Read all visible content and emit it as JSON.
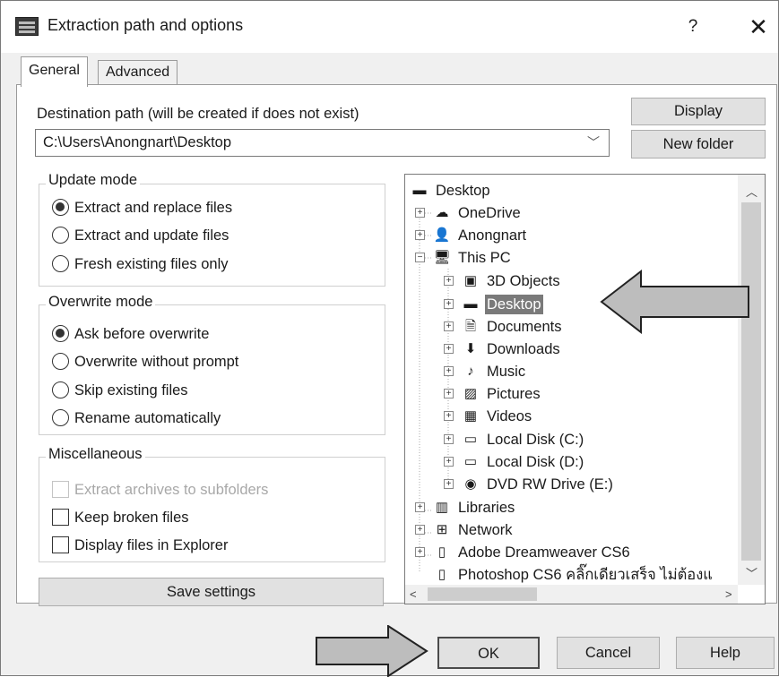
{
  "window": {
    "title": "Extraction path and options",
    "help_glyph": "?",
    "close_glyph": "✕"
  },
  "tabs": [
    {
      "label": "General"
    },
    {
      "label": "Advanced"
    }
  ],
  "destination": {
    "label": "Destination path (will be created if does not exist)",
    "value": "C:\\Users\\Anongnart\\Desktop",
    "display_button": "Display",
    "new_folder_button": "New folder"
  },
  "update_mode": {
    "title": "Update mode",
    "options": [
      {
        "label": "Extract and replace files",
        "selected": true
      },
      {
        "label": "Extract and update files",
        "selected": false
      },
      {
        "label": "Fresh existing files only",
        "selected": false
      }
    ]
  },
  "overwrite_mode": {
    "title": "Overwrite mode",
    "options": [
      {
        "label": "Ask before overwrite",
        "selected": true
      },
      {
        "label": "Overwrite without prompt",
        "selected": false
      },
      {
        "label": "Skip existing files",
        "selected": false
      },
      {
        "label": "Rename automatically",
        "selected": false
      }
    ]
  },
  "misc": {
    "title": "Miscellaneous",
    "options": [
      {
        "label": "Extract archives to subfolders",
        "checked": false,
        "disabled": true
      },
      {
        "label": "Keep broken files",
        "checked": false,
        "disabled": false
      },
      {
        "label": "Display files in Explorer",
        "checked": false,
        "disabled": false
      }
    ]
  },
  "save_settings": "Save settings",
  "tree": {
    "items": [
      {
        "label": "Desktop",
        "icon": "desktop-icon"
      },
      {
        "label": "OneDrive",
        "icon": "cloud-icon"
      },
      {
        "label": "Anongnart",
        "icon": "user-icon"
      },
      {
        "label": "This PC",
        "icon": "computer-icon"
      },
      {
        "label": "3D Objects",
        "icon": "cube-icon"
      },
      {
        "label": "Desktop",
        "icon": "desktop-icon",
        "selected": true
      },
      {
        "label": "Documents",
        "icon": "document-icon"
      },
      {
        "label": "Downloads",
        "icon": "download-icon"
      },
      {
        "label": "Music",
        "icon": "music-icon"
      },
      {
        "label": "Pictures",
        "icon": "pictures-icon"
      },
      {
        "label": "Videos",
        "icon": "film-icon"
      },
      {
        "label": "Local Disk (C:)",
        "icon": "drive-icon"
      },
      {
        "label": "Local Disk (D:)",
        "icon": "drive-icon"
      },
      {
        "label": "DVD RW Drive (E:)",
        "icon": "dvd-icon"
      },
      {
        "label": "Libraries",
        "icon": "library-icon"
      },
      {
        "label": "Network",
        "icon": "network-icon"
      },
      {
        "label": "Adobe Dreamweaver CS6",
        "icon": "file-icon"
      },
      {
        "label": "Photoshop CS6 คลิ๊กเดียวเสร็จ ไม่ต้องแ",
        "icon": "file-icon"
      }
    ]
  },
  "buttons": {
    "ok": "OK",
    "cancel": "Cancel",
    "help": "Help"
  }
}
